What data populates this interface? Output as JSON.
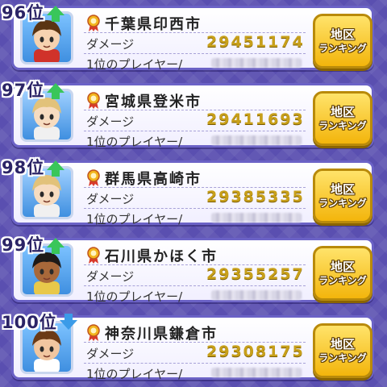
{
  "screen": "regional-damage-ranking",
  "colors": {
    "background": "#5a4fb0",
    "card_border": "#6b62c6",
    "damage_value": "#c8a01a",
    "button": "#f3b50c",
    "rank_up": "#39c65a",
    "rank_down": "#3b9be8"
  },
  "rows": [
    {
      "rank": "96位",
      "trend": "up",
      "region": "千葉県印西市",
      "damage_label": "ダメージ",
      "damage": "29451174",
      "top_player_label": "1位のプレイヤー/",
      "button_line1": "地区",
      "button_line2": "ランキング",
      "avatar_icon": "boy-brown-hair-avatar"
    },
    {
      "rank": "97位",
      "trend": "up",
      "region": "宮城県登米市",
      "damage_label": "ダメージ",
      "damage": "29411693",
      "top_player_label": "1位のプレイヤー/",
      "button_line1": "地区",
      "button_line2": "ランキング",
      "avatar_icon": "blonde-hair-avatar"
    },
    {
      "rank": "98位",
      "trend": "up",
      "region": "群馬県高崎市",
      "damage_label": "ダメージ",
      "damage": "29385335",
      "top_player_label": "1位のプレイヤー/",
      "button_line1": "地区",
      "button_line2": "ランキング",
      "avatar_icon": "blonde-hair-avatar"
    },
    {
      "rank": "99位",
      "trend": "up",
      "region": "石川県かほく市",
      "damage_label": "ダメージ",
      "damage": "29355257",
      "top_player_label": "1位のプレイヤー/",
      "button_line1": "地区",
      "button_line2": "ランキング",
      "avatar_icon": "dark-spiky-hair-avatar"
    },
    {
      "rank": "100位",
      "trend": "down",
      "region": "神奈川県鎌倉市",
      "damage_label": "ダメージ",
      "damage": "29308175",
      "top_player_label": "1位のプレイヤー/",
      "button_line1": "地区",
      "button_line2": "ランキング",
      "avatar_icon": "brown-hair-boy-avatar"
    }
  ]
}
